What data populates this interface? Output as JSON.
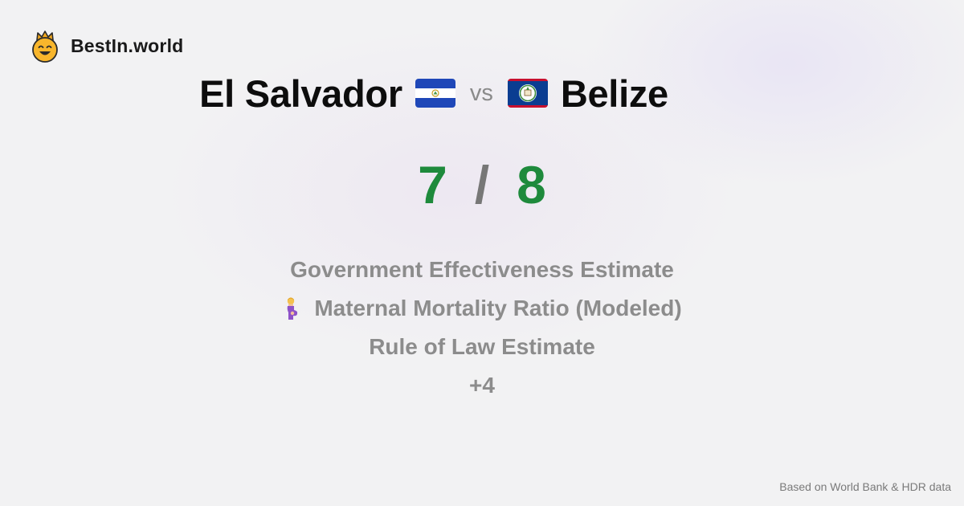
{
  "brand": {
    "name": "BestIn.world",
    "icon": "crowned-smiley-icon"
  },
  "comparison": {
    "left_country": "El Salvador",
    "left_flag": "el-salvador-flag-icon",
    "vs": "vs",
    "right_country": "Belize",
    "right_flag": "belize-flag-icon"
  },
  "score": {
    "left": "7",
    "separator": "/",
    "right": "8",
    "color": "#1e8a3c"
  },
  "metrics": [
    {
      "label": "Government Effectiveness Estimate"
    },
    {
      "label": "Maternal Mortality Ratio (Modeled)",
      "icon": "pregnant-woman-icon"
    },
    {
      "label": "Rule of Law Estimate"
    }
  ],
  "more_label": "+4",
  "footer": {
    "text": "Based on World Bank & HDR data"
  }
}
